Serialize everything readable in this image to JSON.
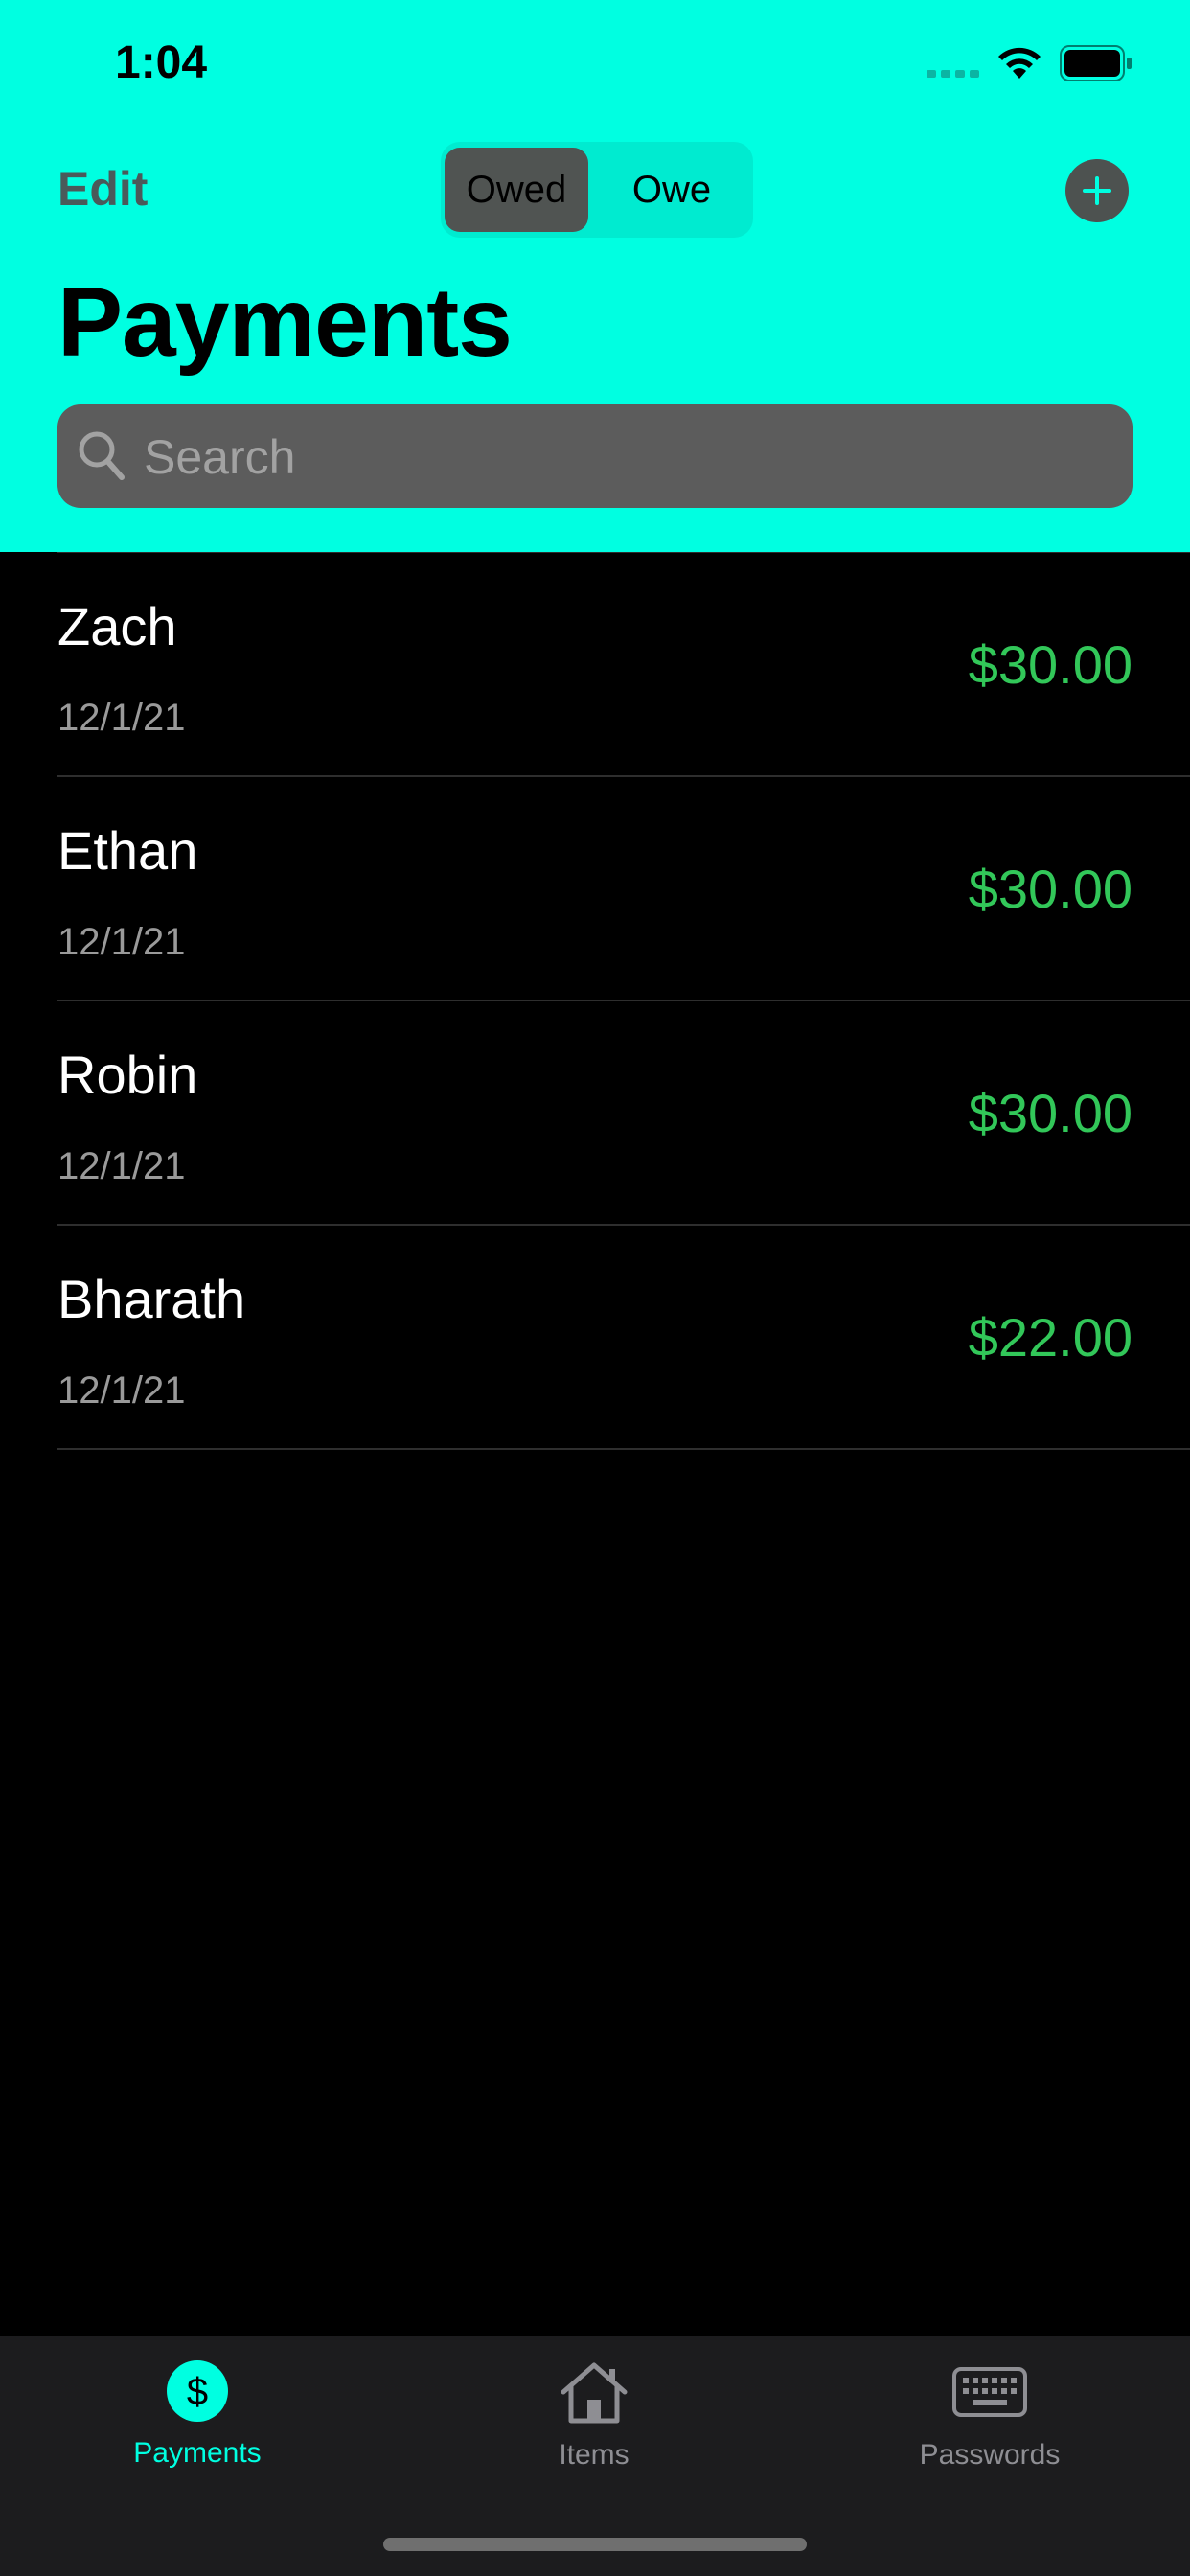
{
  "status_bar": {
    "time": "1:04"
  },
  "nav": {
    "edit_label": "Edit",
    "segments": [
      "Owed",
      "Owe"
    ],
    "selected_segment": "Owed",
    "add_icon": "plus-circle-icon"
  },
  "title": "Payments",
  "search": {
    "placeholder": "Search",
    "value": ""
  },
  "payments": [
    {
      "name": "Zach",
      "date": "12/1/21",
      "amount": "$30.00"
    },
    {
      "name": "Ethan",
      "date": "12/1/21",
      "amount": "$30.00"
    },
    {
      "name": "Robin",
      "date": "12/1/21",
      "amount": "$30.00"
    },
    {
      "name": "Bharath",
      "date": "12/1/21",
      "amount": "$22.00"
    }
  ],
  "tabs": [
    {
      "label": "Payments",
      "icon": "dollar-circle-icon",
      "selected": true
    },
    {
      "label": "Items",
      "icon": "house-icon",
      "selected": false
    },
    {
      "label": "Passwords",
      "icon": "keyboard-icon",
      "selected": false
    }
  ],
  "colors": {
    "accent": "#00FFE1",
    "amount_green": "#32C759",
    "background": "#000000",
    "tabbar": "#1C1C1E"
  }
}
